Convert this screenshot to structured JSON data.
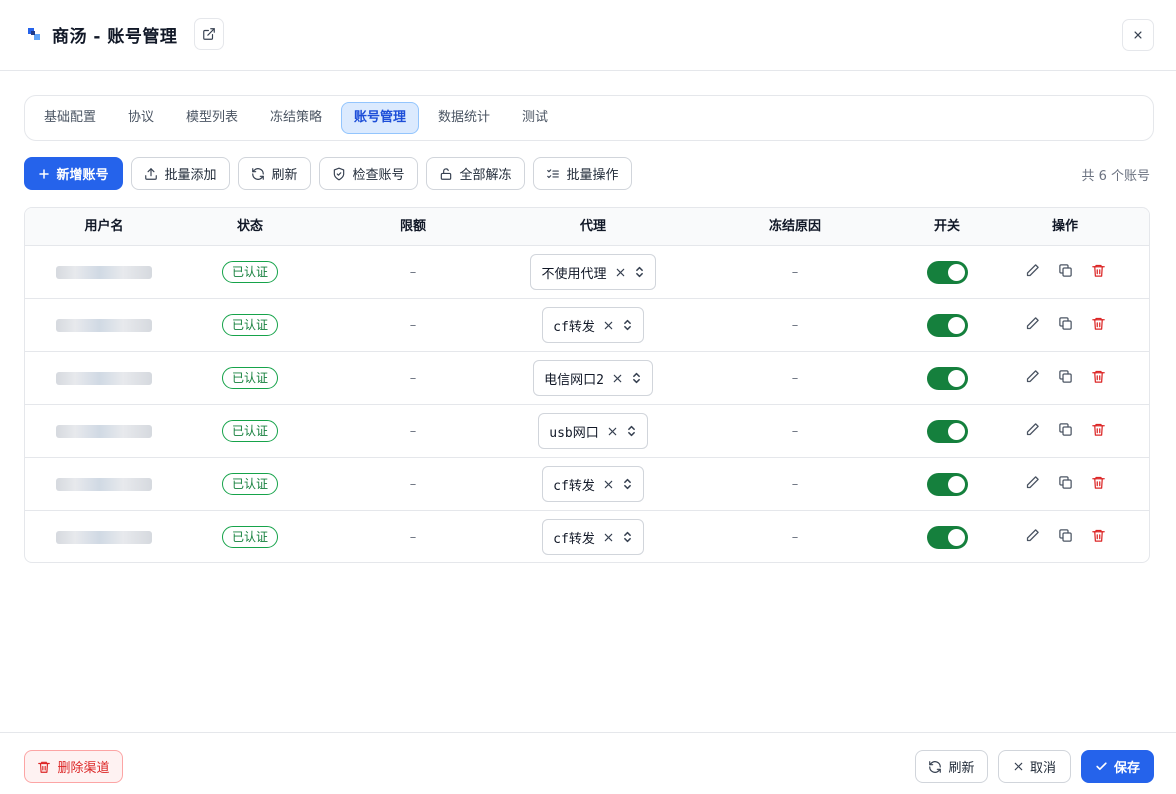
{
  "header": {
    "title": "商汤 - 账号管理",
    "icons": {
      "logo": "logo-icon",
      "open": "external-link-icon",
      "close": "close-icon"
    }
  },
  "tabs": [
    {
      "label": "基础配置",
      "active": false
    },
    {
      "label": "协议",
      "active": false
    },
    {
      "label": "模型列表",
      "active": false
    },
    {
      "label": "冻结策略",
      "active": false
    },
    {
      "label": "账号管理",
      "active": true
    },
    {
      "label": "数据统计",
      "active": false
    },
    {
      "label": "测试",
      "active": false
    }
  ],
  "toolbar": {
    "add": "新增账号",
    "batch_add": "批量添加",
    "refresh": "刷新",
    "check": "检查账号",
    "unfreeze_all": "全部解冻",
    "batch_ops": "批量操作",
    "count": "共 6 个账号"
  },
  "table": {
    "columns": [
      "用户名",
      "状态",
      "限额",
      "代理",
      "冻结原因",
      "开关",
      "操作"
    ],
    "rows": [
      {
        "username": "",
        "status": "已认证",
        "limit": "–",
        "proxy": "不使用代理",
        "freeze_reason": "–",
        "enabled": true
      },
      {
        "username": "",
        "status": "已认证",
        "limit": "–",
        "proxy": "cf转发",
        "freeze_reason": "–",
        "enabled": true
      },
      {
        "username": "",
        "status": "已认证",
        "limit": "–",
        "proxy": "电信网口2",
        "freeze_reason": "–",
        "enabled": true
      },
      {
        "username": "",
        "status": "已认证",
        "limit": "–",
        "proxy": "usb网口",
        "freeze_reason": "–",
        "enabled": true
      },
      {
        "username": "",
        "status": "已认证",
        "limit": "–",
        "proxy": "cf转发",
        "freeze_reason": "–",
        "enabled": true
      },
      {
        "username": "",
        "status": "已认证",
        "limit": "–",
        "proxy": "cf转发",
        "freeze_reason": "–",
        "enabled": true
      }
    ]
  },
  "footer": {
    "delete": "删除渠道",
    "refresh": "刷新",
    "cancel": "取消",
    "save": "保存"
  },
  "colors": {
    "primary": "#2563eb",
    "success": "#15803d",
    "danger": "#dc2626",
    "border": "#e5e7eb"
  }
}
